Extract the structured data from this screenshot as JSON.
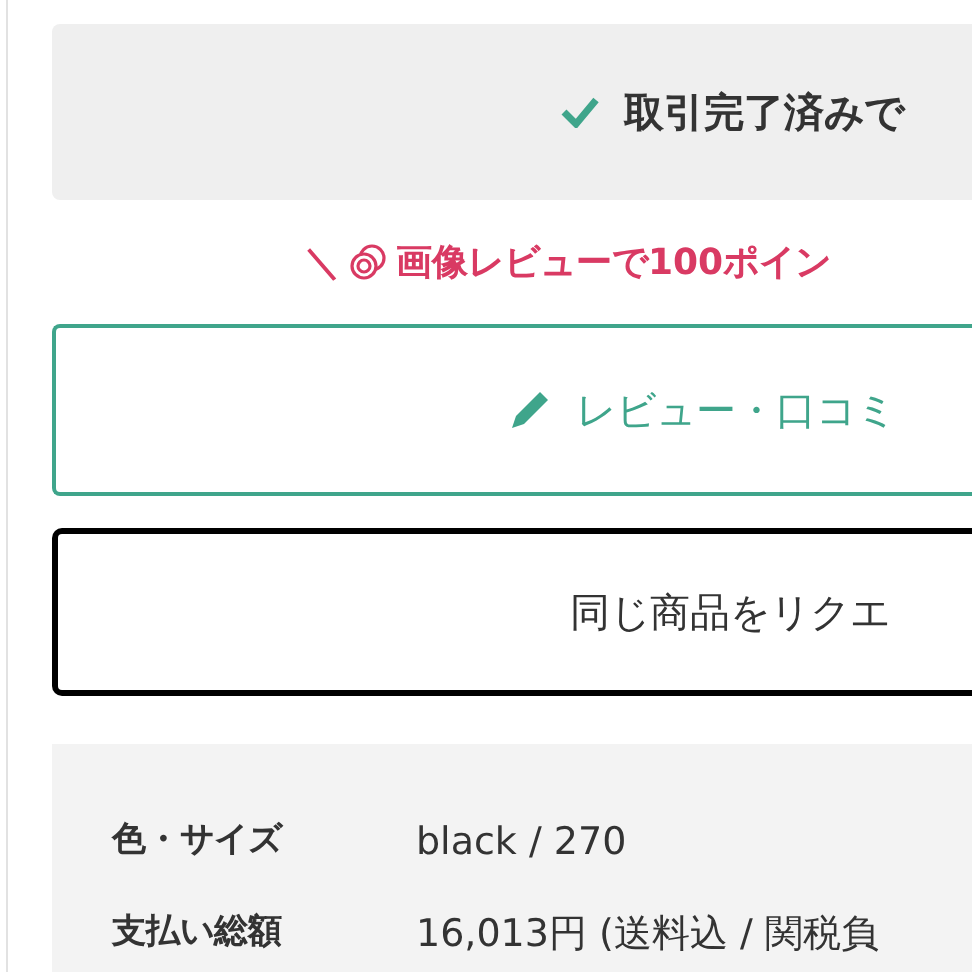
{
  "status": {
    "text": "取引完了済みで"
  },
  "promo": {
    "mark": "＼",
    "text": "画像レビューで100ポイン"
  },
  "review_button": {
    "label": "レビュー・口コミ"
  },
  "request_button": {
    "label": "同じ商品をリクエ"
  },
  "details": [
    {
      "label": "色・サイズ",
      "value": "black / 270"
    },
    {
      "label": "支払い総額",
      "value": "16,013円 (送料込 / 関税負"
    }
  ]
}
